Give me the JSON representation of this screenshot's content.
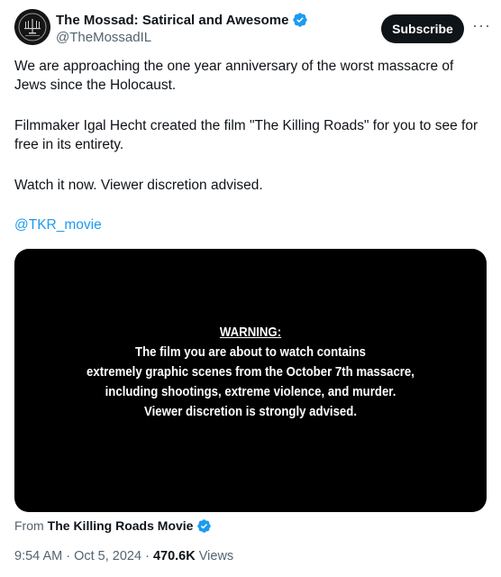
{
  "author": {
    "display_name": "The Mossad: Satirical and Awesome",
    "handle": "@TheMossadIL",
    "verified_color": "#1d9bf0"
  },
  "actions": {
    "subscribe_label": "Subscribe",
    "more_label": "···"
  },
  "tweet": {
    "paragraph1": "We are approaching the one year anniversary of the worst massacre of Jews since the Holocaust.",
    "paragraph2": "Filmmaker Igal Hecht created the film \"The Killing Roads\" for you to see for free in its entirety.",
    "paragraph3": "Watch it now. Viewer discretion advised.",
    "mention": "@TKR_movie"
  },
  "media": {
    "warning_title": "WARNING:",
    "warning_lines": [
      "The film you are about to watch contains",
      "extremely graphic scenes from the October 7th massacre,",
      "including shootings, extreme violence, and murder.",
      "Viewer discretion is strongly advised."
    ]
  },
  "source": {
    "prefix": "From",
    "name": "The Killing Roads Movie"
  },
  "meta": {
    "time": "9:54 AM",
    "separator": " · ",
    "date": "Oct 5, 2024",
    "views_count": "470.6K",
    "views_label": "Views"
  }
}
